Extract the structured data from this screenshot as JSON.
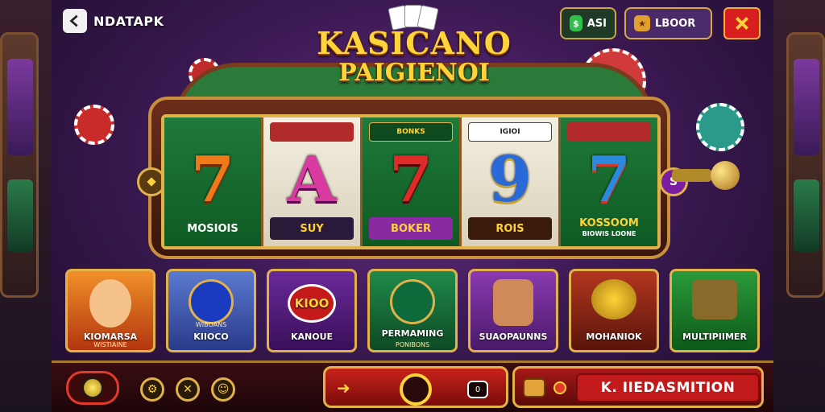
{
  "brand": {
    "name": "NDATAPK"
  },
  "header": {
    "currency_left": {
      "value": "ASI",
      "icon": "cash-icon"
    },
    "currency_right": {
      "value": "LBOOR",
      "icon": "ticket-icon"
    }
  },
  "title": {
    "line1": "KASICANO",
    "line2": "PAIGIENOI"
  },
  "reels": [
    {
      "top": "",
      "symbol": "7",
      "bottom": "MOSIOIS",
      "color": "#f07a1a"
    },
    {
      "top": "",
      "symbol": "A",
      "bottom": "SUY",
      "color": "#d83aa0"
    },
    {
      "top": "BONKS",
      "symbol": "7",
      "bottom": "BOKER",
      "color": "#e02a2a"
    },
    {
      "top": "IGIOI",
      "symbol": "9",
      "bottom": "ROIS",
      "color": "#2a6ad8"
    },
    {
      "top": "",
      "symbol": "7",
      "bottom": "KOSSOOM",
      "bottom_sub": "BIOWIS LOONE",
      "color": "#2a8ae0"
    }
  ],
  "games": [
    {
      "title": "KIOMARSA",
      "sub": "WISTIAINE",
      "art": ""
    },
    {
      "title": "KIIOCO",
      "sub": "WIBOANS",
      "art": ""
    },
    {
      "title": "KANOUE",
      "sub": "",
      "art": "KIOO"
    },
    {
      "title": "PERMAMING",
      "sub": "PONIBONS",
      "art": ""
    },
    {
      "title": "SUAOPAUNNS",
      "sub": "",
      "art": ""
    },
    {
      "title": "MOHANIOK",
      "sub": "",
      "art": ""
    },
    {
      "title": "MULTIPIIMER",
      "sub": "",
      "art": ""
    }
  ],
  "bottom_bar": {
    "spin_small": "0",
    "cta_label": "K. IIEDASMITION"
  },
  "colors": {
    "gold": "#e2b24a",
    "red": "#c8221a",
    "green": "#1f7a3a"
  }
}
